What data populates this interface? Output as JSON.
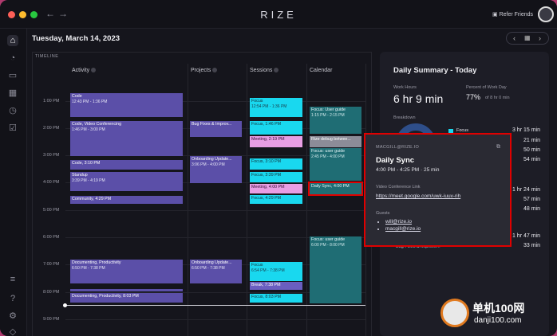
{
  "app": {
    "title": "RIZE",
    "refer_label": "Refer Friends"
  },
  "header": {
    "date": "Tuesday, March 14, 2023",
    "prev_icon": "chevron-left",
    "calendar_icon": "calendar",
    "next_icon": "chevron-right"
  },
  "timeline": {
    "label": "TIMELINE",
    "columns": [
      "Activity",
      "Projects",
      "Sessions",
      "Calendar"
    ],
    "hours": [
      "1:00 PM",
      "2:00 PM",
      "3:00 PM",
      "4:00 PM",
      "5:00 PM",
      "6:00 PM",
      "7:00 PM",
      "8:00 PM",
      "9:00 PM"
    ],
    "activity": [
      {
        "title": "Code",
        "time": "12:43 PM - 1:36 PM"
      },
      {
        "title": "Code, Video Conferencing",
        "time": "1:46 PM - 3:00 PM"
      },
      {
        "title": "Code, 3:10 PM",
        "time": ""
      },
      {
        "title": "Standup",
        "time": "3:39 PM - 4:19 PM"
      },
      {
        "title": "Community, 4:29 PM",
        "time": ""
      },
      {
        "title": "Documenting, Productivity",
        "time": "6:50 PM - 7:38 PM"
      },
      {
        "title": "Documenting, Productivity, 8:03 PM",
        "time": ""
      }
    ],
    "projects": [
      {
        "title": "Bug Fixes & Improv...",
        "time": ""
      },
      {
        "title": "Onboarding Update...",
        "time": "3:06 PM - 4:00 PM"
      },
      {
        "title": "Onboarding Update...",
        "time": "6:50 PM - 7:38 PM"
      }
    ],
    "sessions": [
      {
        "title": "Focus",
        "time": "12:54 PM - 1:36 PM"
      },
      {
        "title": "Focus, 1:46 PM",
        "time": ""
      },
      {
        "title": "Meeting, 2:19 PM",
        "time": ""
      },
      {
        "title": "Focus, 3:10 PM",
        "time": ""
      },
      {
        "title": "Focus, 3:39 PM",
        "time": ""
      },
      {
        "title": "Meeting, 4:00 PM",
        "time": ""
      },
      {
        "title": "Focus, 4:29 PM",
        "time": ""
      },
      {
        "title": "Focus",
        "time": "6:54 PM - 7:38 PM"
      },
      {
        "title": "Break, 7:38 PM",
        "time": ""
      },
      {
        "title": "Focus, 8:03 PM",
        "time": ""
      }
    ],
    "calendar": [
      {
        "title": "Focus: User guide",
        "time": "1:15 PM - 2:15 PM"
      },
      {
        "title": "Rize debug betwee...",
        "time": ""
      },
      {
        "title": "Focus: user guide",
        "time": "2:45 PM - 4:00 PM"
      },
      {
        "title": "Daily Sync, 4:00 PM",
        "time": ""
      },
      {
        "title": "Focus: user guide",
        "time": "6:00 PM - 8:00 PM"
      }
    ]
  },
  "summary": {
    "title": "Daily Summary - Today",
    "work_hours_label": "Work Hours",
    "work_hours_value": "6 hr 9 min",
    "percent_label": "Percent of Work Day",
    "percent_value": "77%",
    "percent_sub": "of 8 hr 0 min",
    "breakdown_label": "Breakdown",
    "breakdown_rows": [
      "3 hr 15 min",
      "21 min",
      "50 min",
      "54 min",
      "1 hr 24 min",
      "57 min",
      "48 min",
      "1 hr 47 min",
      "33 min"
    ],
    "legend_first": "Focus",
    "legend_bottom": "Bug Fixes & Improve..."
  },
  "popup": {
    "email": "MACGILL@RIZE.IO",
    "title": "Daily Sync",
    "time": "4:00 PM - 4:25 PM · 25 min",
    "video_label": "Video Conference Link",
    "video_link": "https://meet.google.com/uwk-iuuv-rih",
    "guests_label": "Guests",
    "guests": [
      "will@rize.io",
      "macgill@rize.io"
    ]
  },
  "watermark": {
    "line1": "单机100网",
    "line2": "danji100.com"
  },
  "colors": {
    "activity": "#5b4fa8",
    "session_focus": "#19d8ef",
    "session_meeting": "#e89ee4",
    "calendar": "#1f6d74",
    "highlight": "#e00000"
  }
}
